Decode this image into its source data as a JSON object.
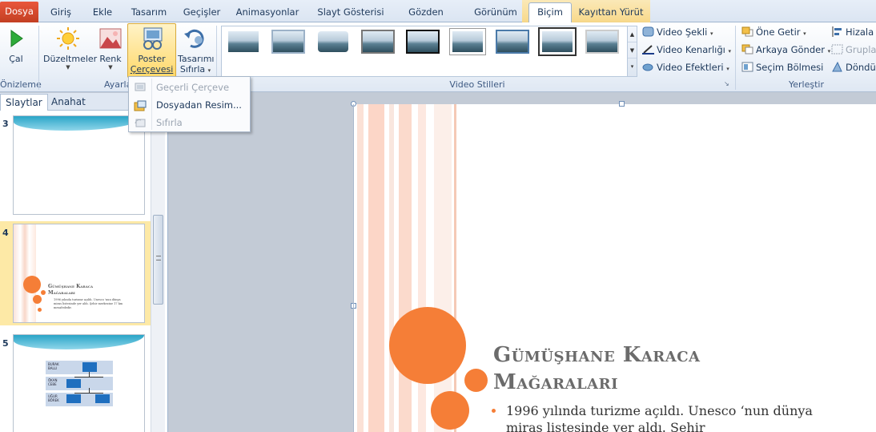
{
  "tabs": [
    "Dosya",
    "Giriş",
    "Ekle",
    "Tasarım",
    "Geçişler",
    "Animasyonlar",
    "Slayt Gösterisi",
    "Gözden Geçir",
    "Görünüm",
    "Biçim",
    "Kayıttan Yürüt"
  ],
  "ribbon": {
    "play_label": "Çal",
    "preview_group": "Önizleme",
    "adjust_group": "Ayarla",
    "corrections_label": "Düzeltmeler",
    "color_label": "Renk",
    "poster_label_1": "Poster",
    "poster_label_2": "Çerçevesi",
    "reset_label_1": "Tasarımı",
    "reset_label_2": "Sıfırla",
    "styles_group": "Video Stilleri",
    "video_shape": "Video Şekli",
    "video_border": "Video Kenarlığı",
    "video_effects": "Video Efektleri",
    "arrange_group": "Yerleştir",
    "bring_forward": "Öne Getir",
    "send_backward": "Arkaya Gönder",
    "selection_pane": "Seçim Bölmesi",
    "align": "Hizala",
    "group": "Grupla",
    "rotate": "Döndür"
  },
  "dropdown": {
    "current_frame": "Geçerli Çerçeve",
    "image_from_file": "Dosyadan Resim...",
    "reset": "Sıfırla"
  },
  "panel": {
    "tab_slides": "Slaytlar",
    "tab_outline": "Anahat",
    "close": "×",
    "slide_numbers": [
      "3",
      "4",
      "5"
    ]
  },
  "thumb4": {
    "title": "Gümüşhane Karaca Mağaraları",
    "text": "1996 yılında turizme açıldı. Unesco 'nun dünya miras listesinde yer aldı. Şehir merkezine 17 km mesafededir."
  },
  "thumb5": {
    "labels": [
      "BURAK BALLI",
      "ÖKAN CEBE",
      "UĞUR BÖREK"
    ]
  },
  "slide": {
    "title_line1": "Gümüşhane Karaca",
    "title_line2": "Mağaraları",
    "bullet": "1996 yılında turizme açıldı. Unesco ‘nun dünya miras listesinde yer aldı. Şehir"
  },
  "colors": {
    "accent": "#f57e37",
    "file_tab": "#c33f22",
    "wave": "#2aa5c7"
  }
}
